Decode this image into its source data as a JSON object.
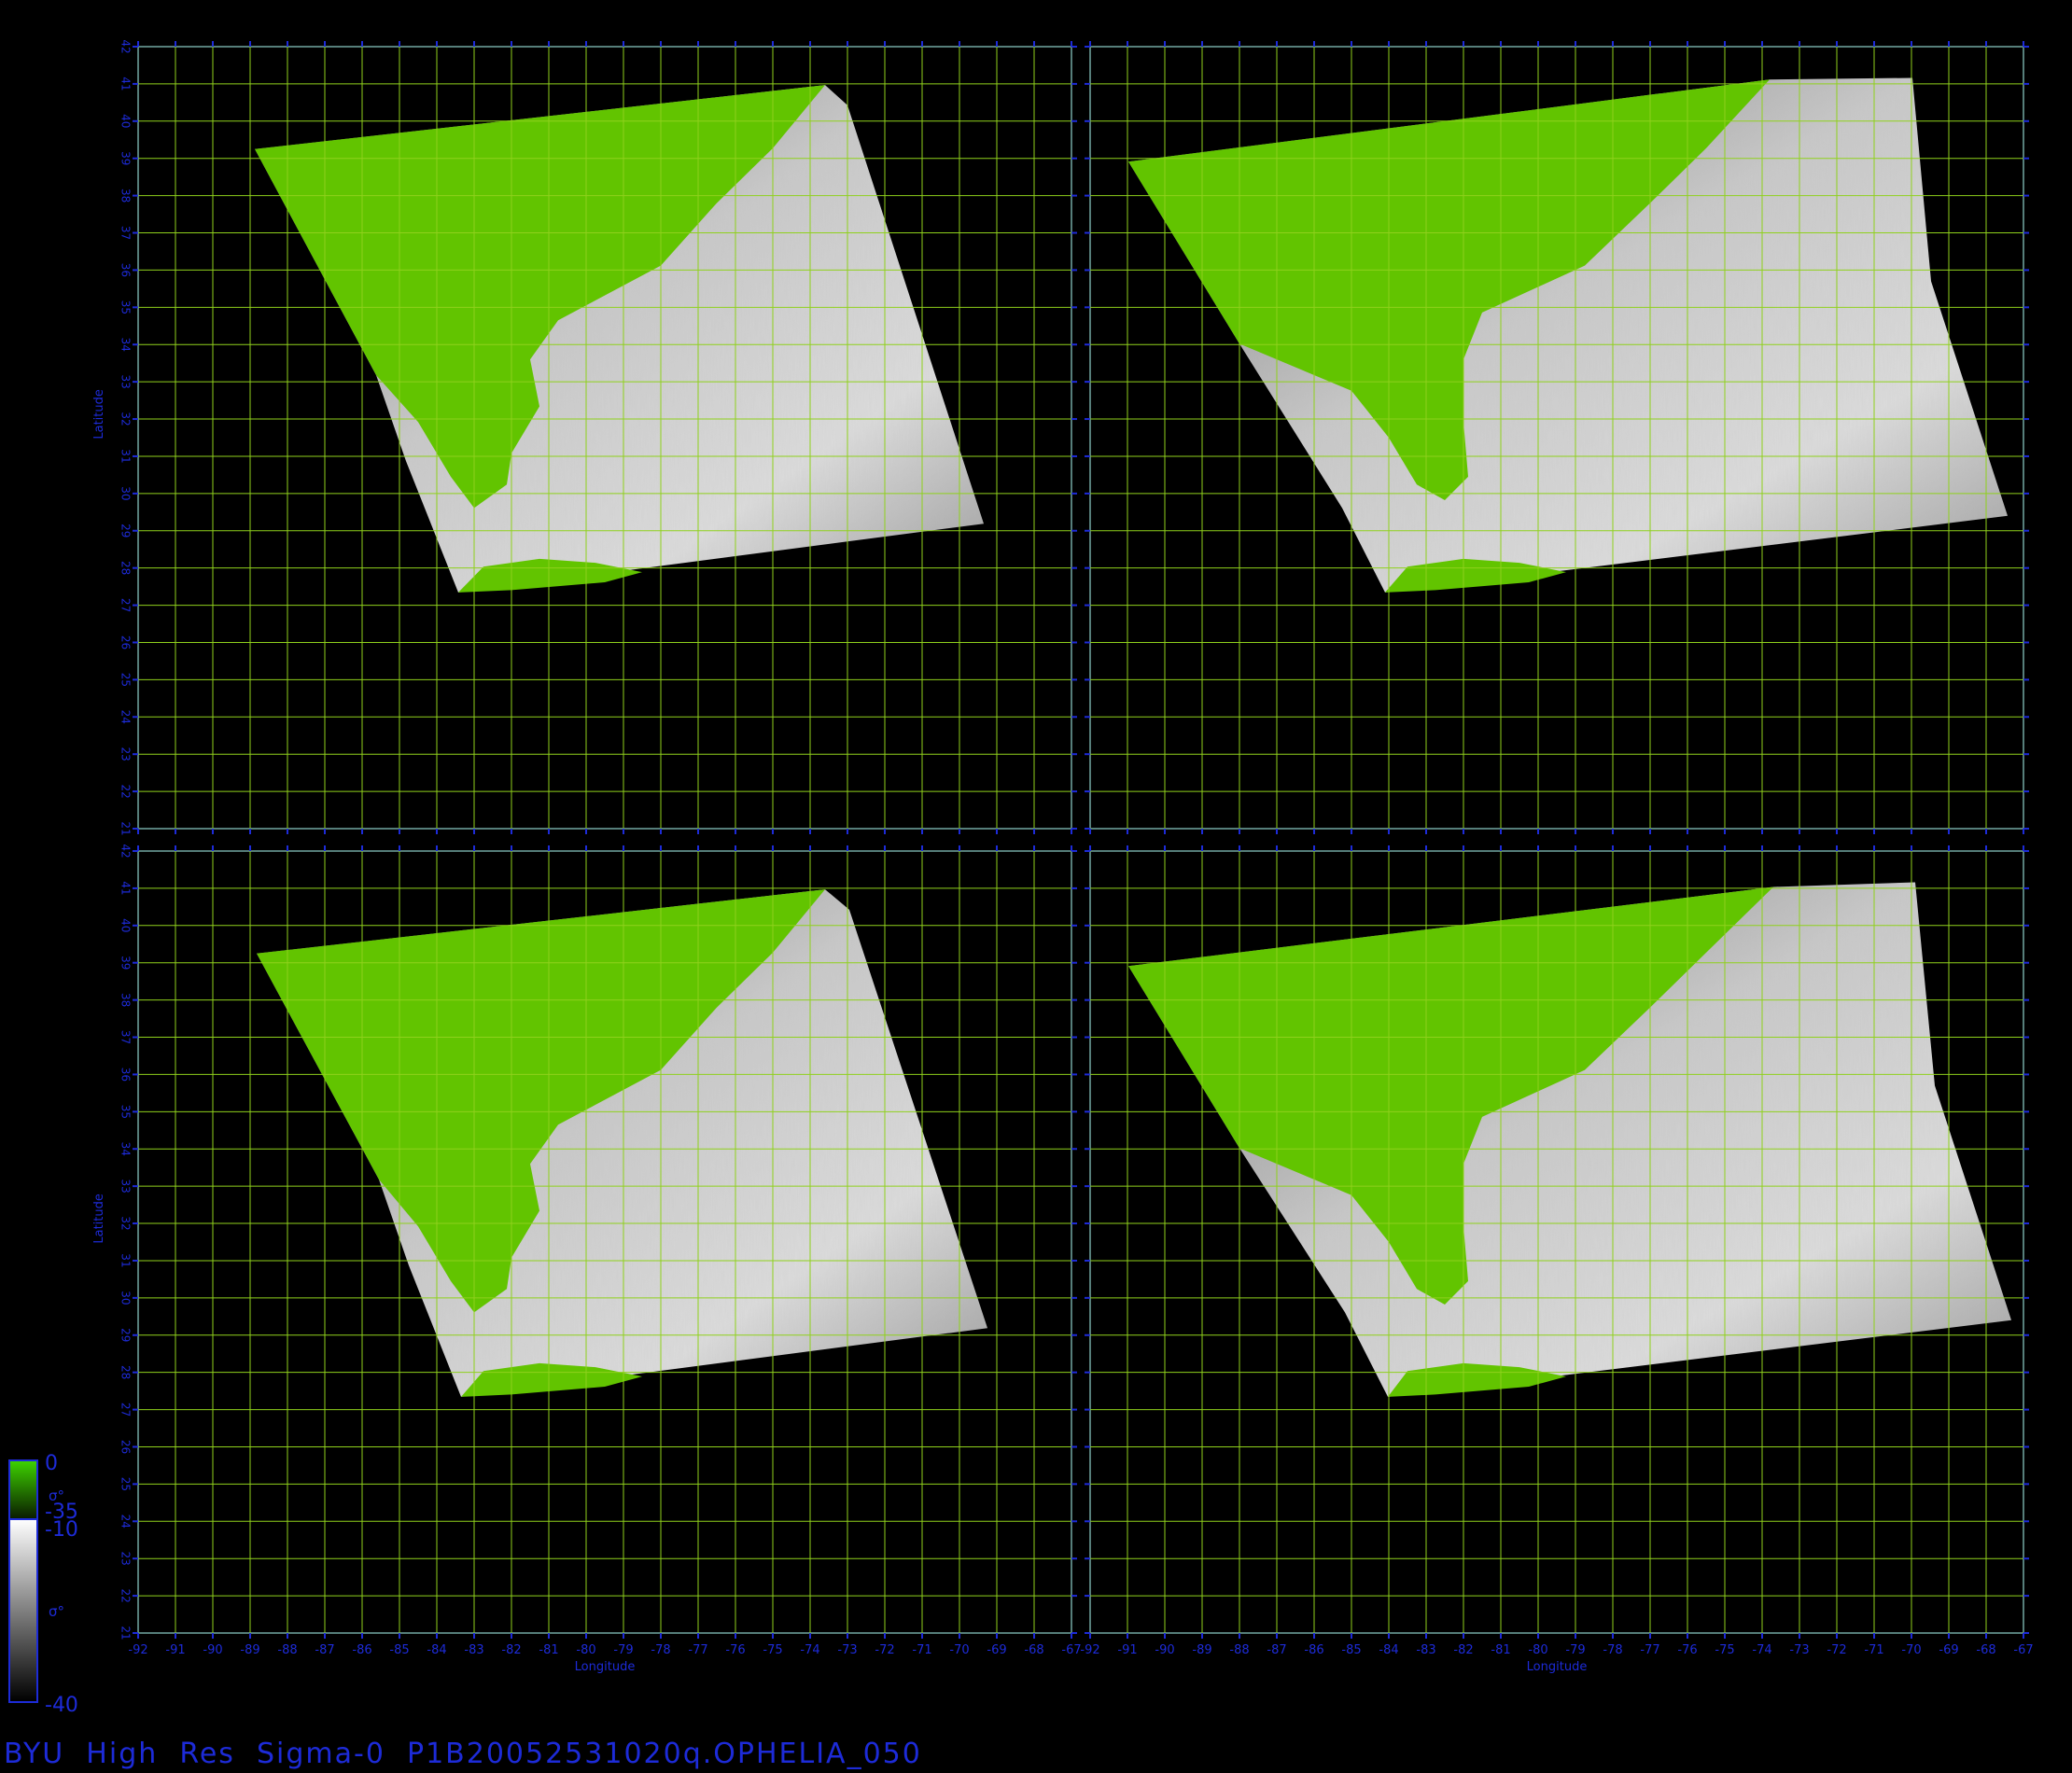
{
  "title": "BYU  High  Res  Sigma-0  P1B20052531020q.OPHELIA_050",
  "colors": {
    "background": "#000000",
    "axis": "#1d2bd8",
    "grid": "#8fd11c",
    "land": "#62c400",
    "ocean_bright": "#e4e4e4",
    "ocean_dark": "#3a3a3a"
  },
  "axes": {
    "xlabel": "Longitude",
    "ylabel": "Latitude",
    "lon_range": [
      -92,
      -67
    ],
    "lat_range": [
      21,
      42
    ],
    "lon_ticks": [
      "-92",
      "-91",
      "-90",
      "-89",
      "-88",
      "-87",
      "-86",
      "-85",
      "-84",
      "-83",
      "-82",
      "-81",
      "-80",
      "-79",
      "-78",
      "-77",
      "-76",
      "-75",
      "-74",
      "-73",
      "-72",
      "-71",
      "-70",
      "-69",
      "-68",
      "-67"
    ],
    "lat_ticks": [
      "21",
      "22",
      "23",
      "24",
      "25",
      "26",
      "27",
      "28",
      "29",
      "30",
      "31",
      "32",
      "33",
      "34",
      "35",
      "36",
      "37",
      "38",
      "39",
      "40",
      "41",
      "42"
    ],
    "grid": true
  },
  "panels": [
    {
      "id": "top-left",
      "pass": 1
    },
    {
      "id": "top-right",
      "pass": 2
    },
    {
      "id": "bottom-left",
      "pass": 3
    },
    {
      "id": "bottom-right",
      "pass": 4
    }
  ],
  "colorbar": {
    "land_scale": {
      "top": "0",
      "bottom": "-35",
      "symbol": "σ°"
    },
    "ocean_scale": {
      "top": "-10",
      "bottom": "-40",
      "symbol": "σ°"
    }
  }
}
